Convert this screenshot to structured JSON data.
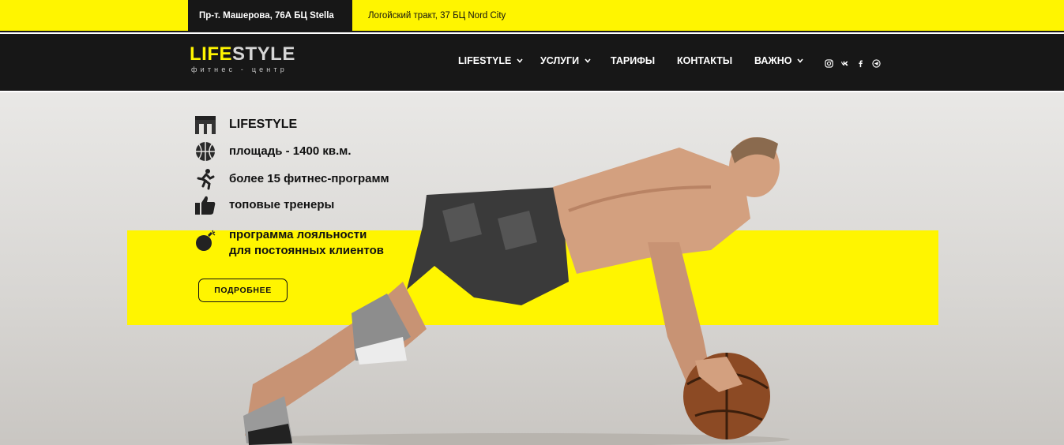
{
  "topbar": {
    "address_1": "Пр-т. Машерова, 76А БЦ Stella",
    "address_2": "Логойский тракт, 37 БЦ Nord City"
  },
  "header": {
    "logo": {
      "part_1": "LIFE",
      "part_2": "STYLE",
      "subtitle": "фитнес - центр"
    },
    "nav": [
      {
        "label": "LIFESTYLE",
        "has_dropdown": true
      },
      {
        "label": "УСЛУГИ",
        "has_dropdown": true
      },
      {
        "label": "ТАРИФЫ",
        "has_dropdown": false
      },
      {
        "label": "КОНТАКТЫ",
        "has_dropdown": false
      },
      {
        "label": "ВАЖНО",
        "has_dropdown": true
      }
    ],
    "social": [
      "instagram-icon",
      "vk-icon",
      "facebook-icon",
      "telegram-icon"
    ]
  },
  "hero": {
    "features": [
      {
        "icon": "gym-building-icon",
        "text": "LIFESTYLE"
      },
      {
        "icon": "basketball-icon",
        "text": "площадь - 1400 кв.м."
      },
      {
        "icon": "runner-icon",
        "text": "более 15 фитнес-программ"
      },
      {
        "icon": "thumbs-up-icon",
        "text": "топовые тренеры"
      },
      {
        "icon": "bomb-icon",
        "text_line_1": "программа лояльности",
        "text_line_2": "для постоянных клиентов"
      }
    ],
    "more_button": "ПОДРОБНЕЕ"
  },
  "colors": {
    "accent": "#fff500",
    "dark": "#171717"
  }
}
